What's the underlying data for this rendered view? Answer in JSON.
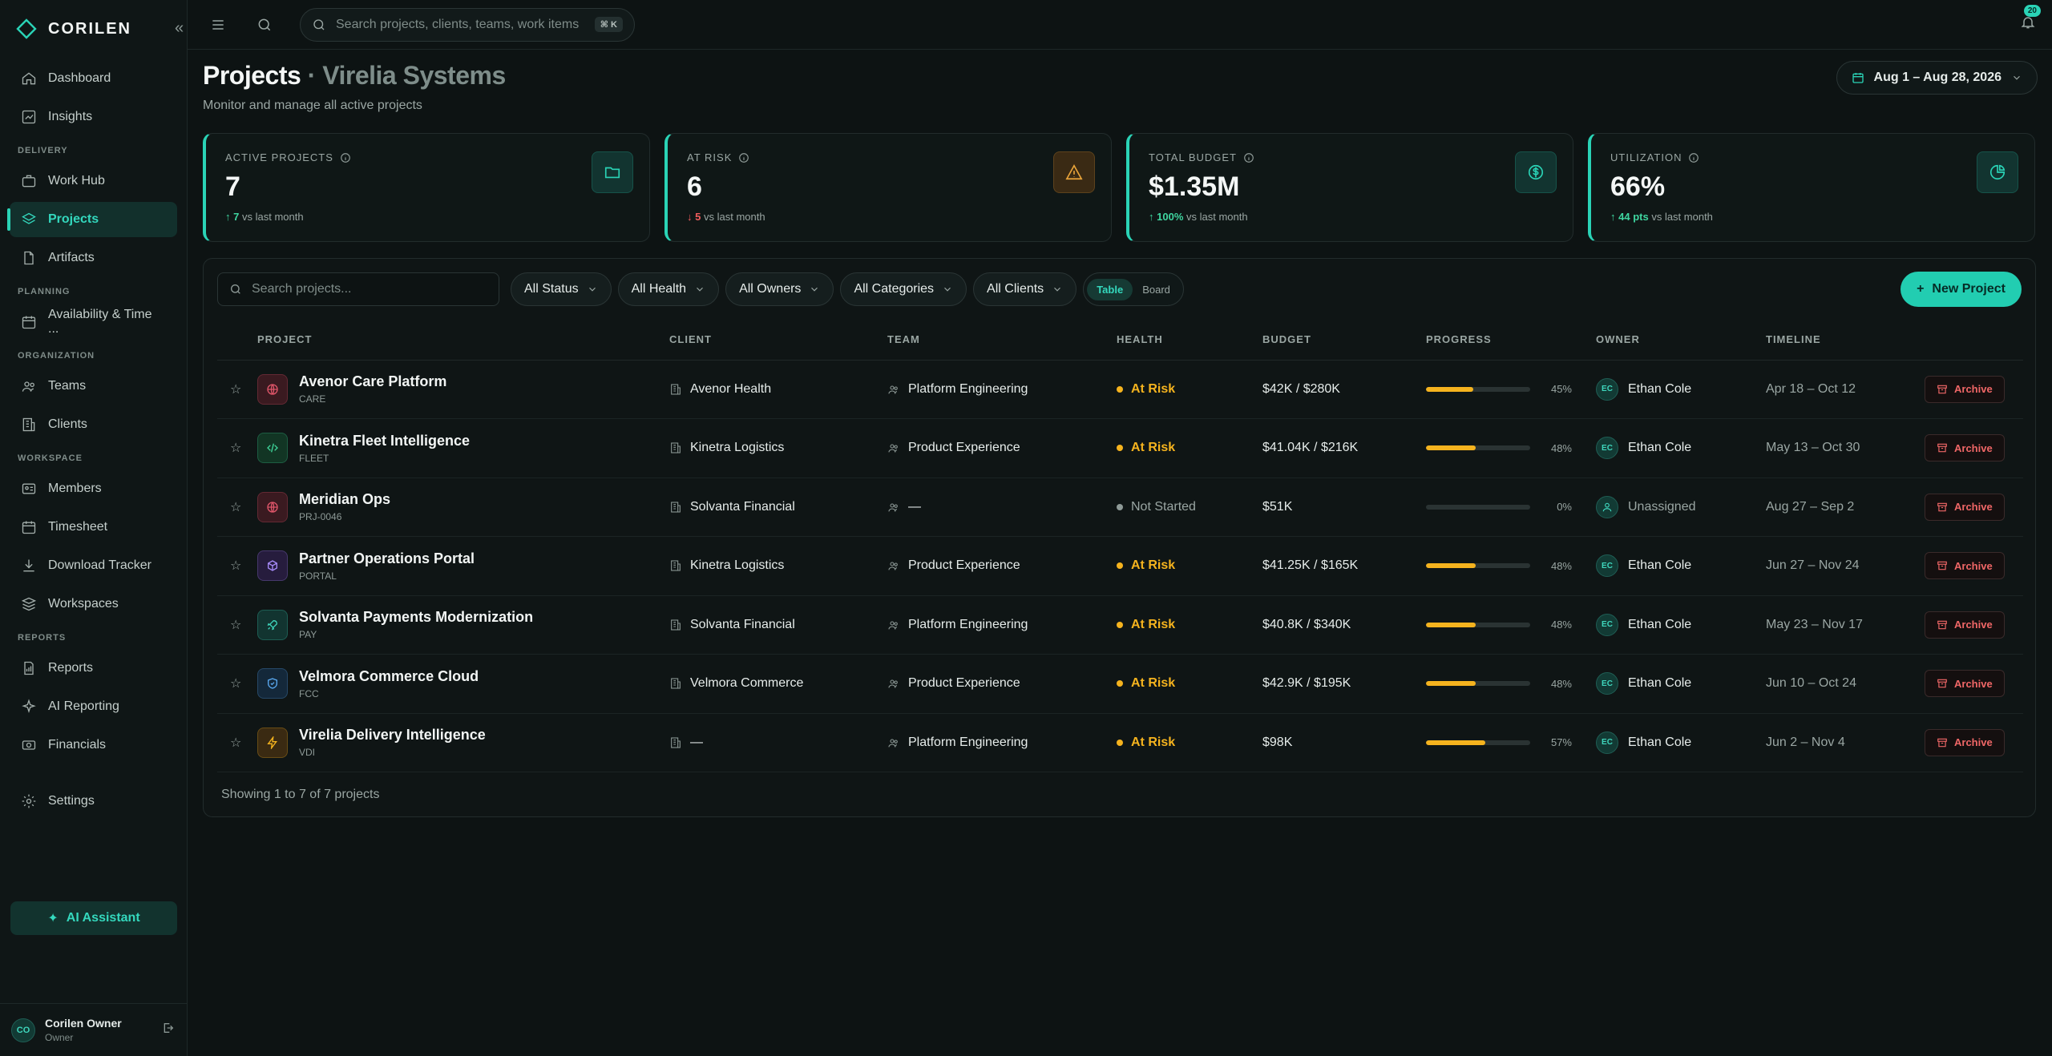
{
  "brand": {
    "name": "CORILEN"
  },
  "sidebar": {
    "sections": [
      {
        "title": "",
        "items": [
          {
            "label": "Dashboard",
            "icon": "home-icon",
            "active": false
          },
          {
            "label": "Insights",
            "icon": "chart-icon",
            "active": false
          }
        ]
      },
      {
        "title": "DELIVERY",
        "items": [
          {
            "label": "Work Hub",
            "icon": "briefcase-icon",
            "active": false
          },
          {
            "label": "Projects",
            "icon": "layers-icon",
            "active": true
          },
          {
            "label": "Artifacts",
            "icon": "file-icon",
            "active": false
          }
        ]
      },
      {
        "title": "PLANNING",
        "items": [
          {
            "label": "Availability & Time ...",
            "icon": "calendar-icon",
            "active": false
          }
        ]
      },
      {
        "title": "ORGANIZATION",
        "items": [
          {
            "label": "Teams",
            "icon": "users-icon",
            "active": false
          },
          {
            "label": "Clients",
            "icon": "building-icon",
            "active": false
          }
        ]
      },
      {
        "title": "WORKSPACE",
        "items": [
          {
            "label": "Members",
            "icon": "id-card-icon",
            "active": false
          },
          {
            "label": "Timesheet",
            "icon": "calendar-icon",
            "active": false
          },
          {
            "label": "Download Tracker",
            "icon": "download-icon",
            "active": false
          },
          {
            "label": "Workspaces",
            "icon": "stack-icon",
            "active": false
          }
        ]
      },
      {
        "title": "REPORTS",
        "items": [
          {
            "label": "Reports",
            "icon": "report-icon",
            "active": false
          },
          {
            "label": "AI Reporting",
            "icon": "sparkle-icon",
            "active": false
          },
          {
            "label": "Financials",
            "icon": "money-icon",
            "active": false
          }
        ]
      },
      {
        "title": "",
        "items": [
          {
            "label": "Settings",
            "icon": "gear-icon",
            "active": false
          }
        ]
      }
    ],
    "ai_assistant": "AI Assistant",
    "user": {
      "initials": "CO",
      "name": "Corilen Owner",
      "role": "Owner"
    }
  },
  "topbar": {
    "search_placeholder": "Search projects, clients, teams, work items",
    "shortcut": "⌘ K",
    "notifications": "20"
  },
  "page": {
    "title": "Projects",
    "separator": "·",
    "org": "Virelia Systems",
    "subtitle": "Monitor and manage all active projects",
    "date_range": "Aug 1 – Aug 28, 2026"
  },
  "kpis": [
    {
      "label": "ACTIVE PROJECTS",
      "value": "7",
      "delta": "7",
      "delta_dir": "up",
      "delta_text": "vs last month",
      "icon": "folder-icon",
      "accent": "#2ad3b6"
    },
    {
      "label": "AT RISK",
      "value": "6",
      "delta": "5",
      "delta_dir": "down",
      "delta_text": "vs last month",
      "icon": "warning-icon",
      "accent": "#e9a43a"
    },
    {
      "label": "TOTAL BUDGET",
      "value": "$1.35M",
      "delta": "100%",
      "delta_dir": "up",
      "delta_text": "vs last month",
      "icon": "dollar-icon",
      "accent": "#2ad3b6"
    },
    {
      "label": "UTILIZATION",
      "value": "66%",
      "delta": "44 pts",
      "delta_dir": "up",
      "delta_text": "vs last month",
      "icon": "pie-icon",
      "accent": "#2ad3b6"
    }
  ],
  "filters": {
    "search_placeholder": "Search projects...",
    "dropdowns": [
      "All Status",
      "All Health",
      "All Owners",
      "All Categories",
      "All Clients"
    ],
    "views": [
      {
        "label": "Table",
        "active": true
      },
      {
        "label": "Board",
        "active": false
      }
    ],
    "new_project": "New Project"
  },
  "table": {
    "columns": [
      "PROJECT",
      "CLIENT",
      "TEAM",
      "HEALTH",
      "BUDGET",
      "PROGRESS",
      "OWNER",
      "TIMELINE"
    ],
    "rows": [
      {
        "name": "Avenor Care Platform",
        "code": "CARE",
        "icon": "globe-icon",
        "icon_color": "#e0566a",
        "icon_bg": "#3a1a20",
        "client": "Avenor Health",
        "team": "Platform Engineering",
        "health": "At Risk",
        "health_color": "#f5b31e",
        "budget": "$42K / $280K",
        "progress": 45,
        "progress_label": "45%",
        "owner": "Ethan Cole",
        "owner_initials": "EC",
        "timeline": "Apr 18 – Oct 12",
        "action": "Archive"
      },
      {
        "name": "Kinetra Fleet Intelligence",
        "code": "FLEET",
        "icon": "code-icon",
        "icon_color": "#3fd69a",
        "icon_bg": "#123524",
        "client": "Kinetra Logistics",
        "team": "Product Experience",
        "health": "At Risk",
        "health_color": "#f5b31e",
        "budget": "$41.04K / $216K",
        "progress": 48,
        "progress_label": "48%",
        "owner": "Ethan Cole",
        "owner_initials": "EC",
        "timeline": "May 13 – Oct 30",
        "action": "Archive"
      },
      {
        "name": "Meridian Ops",
        "code": "PRJ-0046",
        "icon": "globe-icon",
        "icon_color": "#e0566a",
        "icon_bg": "#3a1a20",
        "client": "Solvanta Financial",
        "team": "—",
        "health": "Not Started",
        "health_color": "#8e9a97",
        "budget": "$51K",
        "progress": 0,
        "progress_label": "0%",
        "owner": "Unassigned",
        "owner_initials": "",
        "timeline": "Aug 27 – Sep 2",
        "action": "Archive"
      },
      {
        "name": "Partner Operations Portal",
        "code": "PORTAL",
        "icon": "cube-icon",
        "icon_color": "#a78bfa",
        "icon_bg": "#261c3d",
        "client": "Kinetra Logistics",
        "team": "Product Experience",
        "health": "At Risk",
        "health_color": "#f5b31e",
        "budget": "$41.25K / $165K",
        "progress": 48,
        "progress_label": "48%",
        "owner": "Ethan Cole",
        "owner_initials": "EC",
        "timeline": "Jun 27 – Nov 24",
        "action": "Archive"
      },
      {
        "name": "Solvanta Payments Modernization",
        "code": "PAY",
        "icon": "rocket-icon",
        "icon_color": "#3fd6bd",
        "icon_bg": "#123430",
        "client": "Solvanta Financial",
        "team": "Platform Engineering",
        "health": "At Risk",
        "health_color": "#f5b31e",
        "budget": "$40.8K / $340K",
        "progress": 48,
        "progress_label": "48%",
        "owner": "Ethan Cole",
        "owner_initials": "EC",
        "timeline": "May 23 – Nov 17",
        "action": "Archive"
      },
      {
        "name": "Velmora Commerce Cloud",
        "code": "FCC",
        "icon": "shield-icon",
        "icon_color": "#5aa9f0",
        "icon_bg": "#14283a",
        "client": "Velmora Commerce",
        "team": "Product Experience",
        "health": "At Risk",
        "health_color": "#f5b31e",
        "budget": "$42.9K / $195K",
        "progress": 48,
        "progress_label": "48%",
        "owner": "Ethan Cole",
        "owner_initials": "EC",
        "timeline": "Jun 10 – Oct 24",
        "action": "Archive"
      },
      {
        "name": "Virelia Delivery Intelligence",
        "code": "VDI",
        "icon": "bolt-icon",
        "icon_color": "#f5b31e",
        "icon_bg": "#3a2a12",
        "client": "—",
        "team": "Platform Engineering",
        "health": "At Risk",
        "health_color": "#f5b31e",
        "budget": "$98K",
        "progress": 57,
        "progress_label": "57%",
        "owner": "Ethan Cole",
        "owner_initials": "EC",
        "timeline": "Jun 2 – Nov 4",
        "action": "Archive"
      }
    ],
    "footer": "Showing 1 to 7 of 7 projects"
  }
}
